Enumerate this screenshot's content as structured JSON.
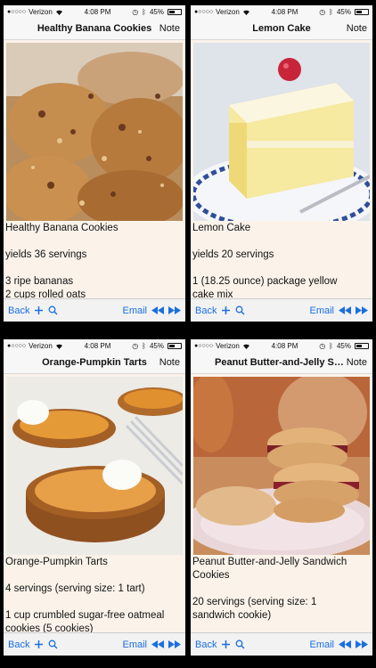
{
  "status": {
    "carrier": "Verizon",
    "time": "4:08 PM",
    "battery": "45%",
    "signal_dots": "●○○○○"
  },
  "toolbar": {
    "back_label": "Back",
    "email_label": "Email",
    "plus_icon": "plus-icon",
    "search_icon": "search-icon",
    "prev_icon": "rewind-icon",
    "next_icon": "fast-forward-icon"
  },
  "note_label": "Note",
  "colors": {
    "accent": "#1a6fe0",
    "background": "#fbf3ea",
    "bar": "#f7f7f7"
  },
  "screens": [
    {
      "title": "Healthy Banana Cookies",
      "text": "Healthy Banana Cookies\n\nyields 36 servings\n\n3 ripe bananas\n2 cups rolled oats"
    },
    {
      "title": "Lemon Cake",
      "text": "Lemon Cake\n\nyields 20 servings\n\n1 (18.25 ounce) package yellow\ncake mix"
    },
    {
      "title": "Orange-Pumpkin Tarts",
      "text": "Orange-Pumpkin Tarts\n\n4 servings (serving size: 1 tart)\n\n1 cup crumbled sugar-free oatmeal\ncookies (5 cookies)"
    },
    {
      "title": "Peanut Butter-and-Jelly Sand...",
      "text": "Peanut Butter-and-Jelly Sandwich\nCookies\n\n20 servings (serving size: 1\nsandwich cookie)"
    }
  ]
}
